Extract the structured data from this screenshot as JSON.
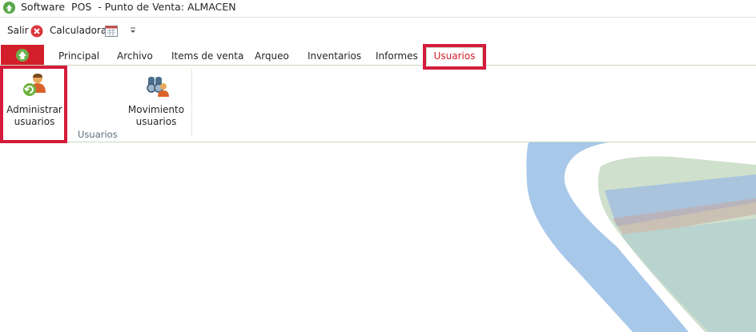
{
  "window": {
    "title": "Software  POS  - Punto de Venta: ALMACEN"
  },
  "quick_access": {
    "salir_label": "Salir",
    "calculadora_label": "Calculadora"
  },
  "tabs": [
    {
      "label": "Principal"
    },
    {
      "label": "Archivo"
    },
    {
      "label": "Items de venta"
    },
    {
      "label": "Arqueo"
    },
    {
      "label": "Inventarios"
    },
    {
      "label": "Informes"
    },
    {
      "label": "Usuarios",
      "active": true
    }
  ],
  "ribbon": {
    "group_label": "Usuarios",
    "buttons": [
      {
        "label_line1": "Administrar",
        "label_line2": "usuarios",
        "icon": "user-refresh-icon"
      },
      {
        "label_line1": "Movimiento",
        "label_line2": "usuarios",
        "icon": "binoculars-user-icon"
      }
    ]
  },
  "colors": {
    "accent": "#d21f2b",
    "highlight": "#d51b3b",
    "tab_border": "#c8d6c0"
  }
}
